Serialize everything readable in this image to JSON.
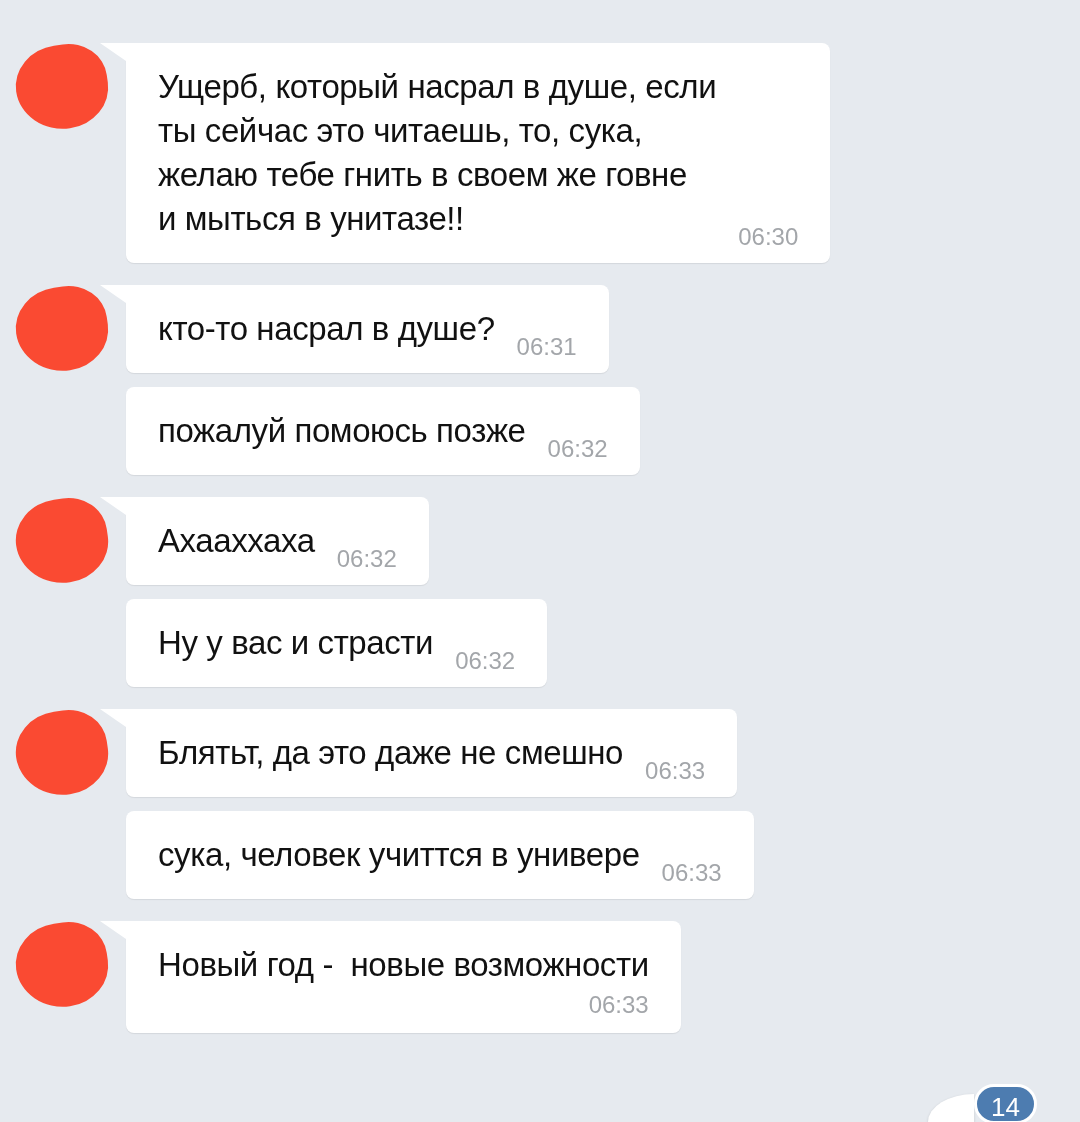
{
  "groups": [
    {
      "avatar_hidden": true,
      "messages": [
        {
          "text": "Ущерб, который насрал в душе, если\nты сейчас это читаешь, то, сука,\nжелаю тебе гнить в своем же говне\nи мыться в унитазе!!",
          "time": "06:30",
          "time_below": false
        }
      ]
    },
    {
      "avatar_hidden": true,
      "messages": [
        {
          "text": "кто-то насрал в душе?",
          "time": "06:31",
          "time_below": false
        },
        {
          "text": "пожалуй помоюсь позже",
          "time": "06:32",
          "time_below": false
        }
      ]
    },
    {
      "avatar_hidden": true,
      "messages": [
        {
          "text": "Ахааххаха",
          "time": "06:32",
          "time_below": false
        },
        {
          "text": "Ну у вас и страсти",
          "time": "06:32",
          "time_below": false
        }
      ]
    },
    {
      "avatar_hidden": true,
      "messages": [
        {
          "text": "Блятьт, да это даже не смешно",
          "time": "06:33",
          "time_below": false
        },
        {
          "text": "сука, человек учиттся в универе",
          "time": "06:33",
          "time_below": false
        }
      ]
    },
    {
      "avatar_hidden": true,
      "messages": [
        {
          "text": "Новый год -  новые возможности",
          "time": "06:33",
          "time_below": true
        }
      ]
    }
  ],
  "scroll_button": {
    "badge": "14"
  }
}
